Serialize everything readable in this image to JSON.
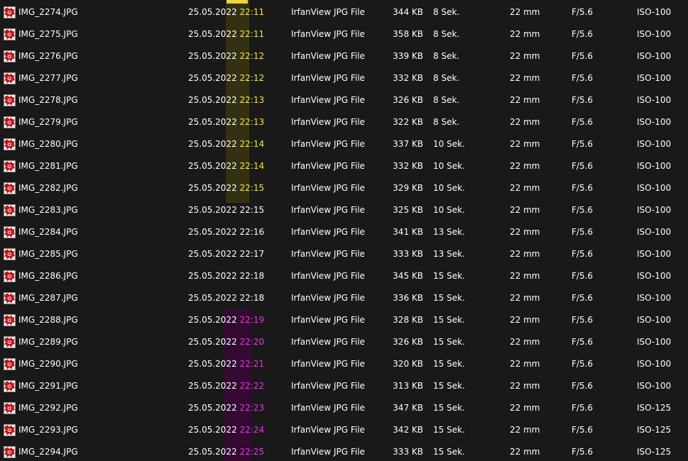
{
  "files": [
    {
      "name": "IMG_2274.JPG",
      "date": "25.05.2022",
      "time": "22:11",
      "highlight": "yellow",
      "type": "IrfanView JPG File",
      "size": "344 KB",
      "exposure": "8 Sek.",
      "focal": "22 mm",
      "fnumber": "F/5.6",
      "iso": "ISO-100"
    },
    {
      "name": "IMG_2275.JPG",
      "date": "25.05.2022",
      "time": "22:11",
      "highlight": "yellow",
      "type": "IrfanView JPG File",
      "size": "358 KB",
      "exposure": "8 Sek.",
      "focal": "22 mm",
      "fnumber": "F/5.6",
      "iso": "ISO-100"
    },
    {
      "name": "IMG_2276.JPG",
      "date": "25.05.2022",
      "time": "22:12",
      "highlight": "yellow",
      "type": "IrfanView JPG File",
      "size": "339 KB",
      "exposure": "8 Sek.",
      "focal": "22 mm",
      "fnumber": "F/5.6",
      "iso": "ISO-100"
    },
    {
      "name": "IMG_2277.JPG",
      "date": "25.05.2022",
      "time": "22:12",
      "highlight": "yellow",
      "type": "IrfanView JPG File",
      "size": "332 KB",
      "exposure": "8 Sek.",
      "focal": "22 mm",
      "fnumber": "F/5.6",
      "iso": "ISO-100"
    },
    {
      "name": "IMG_2278.JPG",
      "date": "25.05.2022",
      "time": "22:13",
      "highlight": "yellow",
      "type": "IrfanView JPG File",
      "size": "326 KB",
      "exposure": "8 Sek.",
      "focal": "22 mm",
      "fnumber": "F/5.6",
      "iso": "ISO-100"
    },
    {
      "name": "IMG_2279.JPG",
      "date": "25.05.2022",
      "time": "22:13",
      "highlight": "yellow",
      "type": "IrfanView JPG File",
      "size": "322 KB",
      "exposure": "8 Sek.",
      "focal": "22 mm",
      "fnumber": "F/5.6",
      "iso": "ISO-100"
    },
    {
      "name": "IMG_2280.JPG",
      "date": "25.05.2022",
      "time": "22:14",
      "highlight": "yellow",
      "type": "IrfanView JPG File",
      "size": "337 KB",
      "exposure": "10 Sek.",
      "focal": "22 mm",
      "fnumber": "F/5.6",
      "iso": "ISO-100"
    },
    {
      "name": "IMG_2281.JPG",
      "date": "25.05.2022",
      "time": "22:14",
      "highlight": "yellow",
      "type": "IrfanView JPG File",
      "size": "332 KB",
      "exposure": "10 Sek.",
      "focal": "22 mm",
      "fnumber": "F/5.6",
      "iso": "ISO-100"
    },
    {
      "name": "IMG_2282.JPG",
      "date": "25.05.2022",
      "time": "22:15",
      "highlight": "yellow",
      "type": "IrfanView JPG File",
      "size": "329 KB",
      "exposure": "10 Sek.",
      "focal": "22 mm",
      "fnumber": "F/5.6",
      "iso": "ISO-100"
    },
    {
      "name": "IMG_2283.JPG",
      "date": "25.05.2022",
      "time": "22:15",
      "highlight": "none",
      "type": "IrfanView JPG File",
      "size": "325 KB",
      "exposure": "10 Sek.",
      "focal": "22 mm",
      "fnumber": "F/5.6",
      "iso": "ISO-100"
    },
    {
      "name": "IMG_2284.JPG",
      "date": "25.05.2022",
      "time": "22:16",
      "highlight": "none",
      "type": "IrfanView JPG File",
      "size": "341 KB",
      "exposure": "13 Sek.",
      "focal": "22 mm",
      "fnumber": "F/5.6",
      "iso": "ISO-100"
    },
    {
      "name": "IMG_2285.JPG",
      "date": "25.05.2022",
      "time": "22:17",
      "highlight": "none",
      "type": "IrfanView JPG File",
      "size": "333 KB",
      "exposure": "13 Sek.",
      "focal": "22 mm",
      "fnumber": "F/5.6",
      "iso": "ISO-100"
    },
    {
      "name": "IMG_2286.JPG",
      "date": "25.05.2022",
      "time": "22:18",
      "highlight": "none",
      "type": "IrfanView JPG File",
      "size": "345 KB",
      "exposure": "15 Sek.",
      "focal": "22 mm",
      "fnumber": "F/5.6",
      "iso": "ISO-100"
    },
    {
      "name": "IMG_2287.JPG",
      "date": "25.05.2022",
      "time": "22:18",
      "highlight": "none",
      "type": "IrfanView JPG File",
      "size": "336 KB",
      "exposure": "15 Sek.",
      "focal": "22 mm",
      "fnumber": "F/5.6",
      "iso": "ISO-100"
    },
    {
      "name": "IMG_2288.JPG",
      "date": "25.05.2022",
      "time": "22:19",
      "highlight": "pink",
      "type": "IrfanView JPG File",
      "size": "328 KB",
      "exposure": "15 Sek.",
      "focal": "22 mm",
      "fnumber": "F/5.6",
      "iso": "ISO-100"
    },
    {
      "name": "IMG_2289.JPG",
      "date": "25.05.2022",
      "time": "22:20",
      "highlight": "pink",
      "type": "IrfanView JPG File",
      "size": "326 KB",
      "exposure": "15 Sek.",
      "focal": "22 mm",
      "fnumber": "F/5.6",
      "iso": "ISO-100"
    },
    {
      "name": "IMG_2290.JPG",
      "date": "25.05.2022",
      "time": "22:21",
      "highlight": "pink",
      "type": "IrfanView JPG File",
      "size": "320 KB",
      "exposure": "15 Sek.",
      "focal": "22 mm",
      "fnumber": "F/5.6",
      "iso": "ISO-100"
    },
    {
      "name": "IMG_2291.JPG",
      "date": "25.05.2022",
      "time": "22:22",
      "highlight": "pink",
      "type": "IrfanView JPG File",
      "size": "313 KB",
      "exposure": "15 Sek.",
      "focal": "22 mm",
      "fnumber": "F/5.6",
      "iso": "ISO-100"
    },
    {
      "name": "IMG_2292.JPG",
      "date": "25.05.2022",
      "time": "22:23",
      "highlight": "pink",
      "type": "IrfanView JPG File",
      "size": "347 KB",
      "exposure": "15 Sek.",
      "focal": "22 mm",
      "fnumber": "F/5.6",
      "iso": "ISO-125"
    },
    {
      "name": "IMG_2293.JPG",
      "date": "25.05.2022",
      "time": "22:24",
      "highlight": "pink",
      "type": "IrfanView JPG File",
      "size": "342 KB",
      "exposure": "15 Sek.",
      "focal": "22 mm",
      "fnumber": "F/5.6",
      "iso": "ISO-125"
    },
    {
      "name": "IMG_2294.JPG",
      "date": "25.05.2022",
      "time": "22:25",
      "highlight": "pink",
      "type": "IrfanView JPG File",
      "size": "333 KB",
      "exposure": "15 Sek.",
      "focal": "22 mm",
      "fnumber": "F/5.6",
      "iso": "ISO-125"
    }
  ],
  "colors": {
    "background": "#191919",
    "text": "#ffffff",
    "highlight_yellow_text": "#f1e64a",
    "highlight_pink_text": "#d93ed9",
    "highlight_yellow_band": "#3a3612",
    "highlight_pink_band": "#360a34",
    "file_icon_red": "#c0171e"
  },
  "icons": {
    "file": "irfanview-jpg-file-icon"
  }
}
